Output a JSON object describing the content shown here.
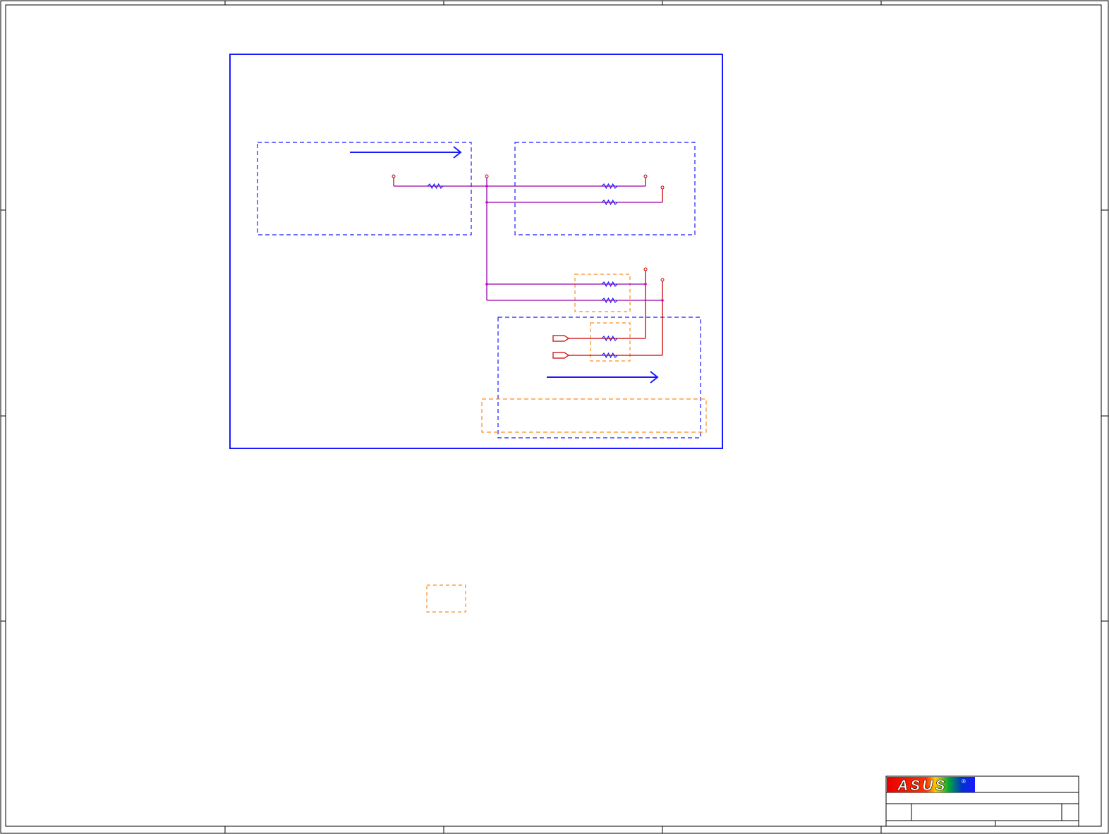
{
  "title_block": {
    "logo_text": "ASUS",
    "logo_registered": "®"
  },
  "colors": {
    "sheet_border": "#000000",
    "container": "#1a1aff",
    "dashed_blue": "#1a1aff",
    "dashed_orange": "#ff8c1a",
    "wire": "#cc0000",
    "wire_purple": "#9900aa",
    "resistor": "#1a1aff",
    "junction": "#cc00cc",
    "logo_red": "#e60000",
    "logo_blue": "#1a1aff"
  },
  "icons": {
    "arrow_top": "arrow-right-icon",
    "arrow_bottom": "arrow-right-icon",
    "resistor": "resistor-icon",
    "port": "connector-port-icon"
  }
}
